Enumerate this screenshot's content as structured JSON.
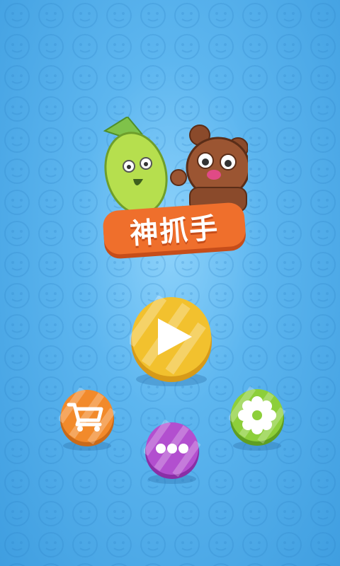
{
  "game": {
    "title": "神抓手"
  },
  "buttons": {
    "play": {
      "icon": "play-icon",
      "color": "#f2c12e"
    },
    "shop": {
      "icon": "shopping-cart-icon",
      "color": "#f28a2b"
    },
    "more": {
      "icon": "more-dots-icon",
      "color": "#b24fcf"
    },
    "settings": {
      "icon": "gear-icon",
      "color": "#8dcf3a"
    }
  },
  "colors": {
    "background": "#5db6ef",
    "title_plate": "#ef6f2c"
  }
}
